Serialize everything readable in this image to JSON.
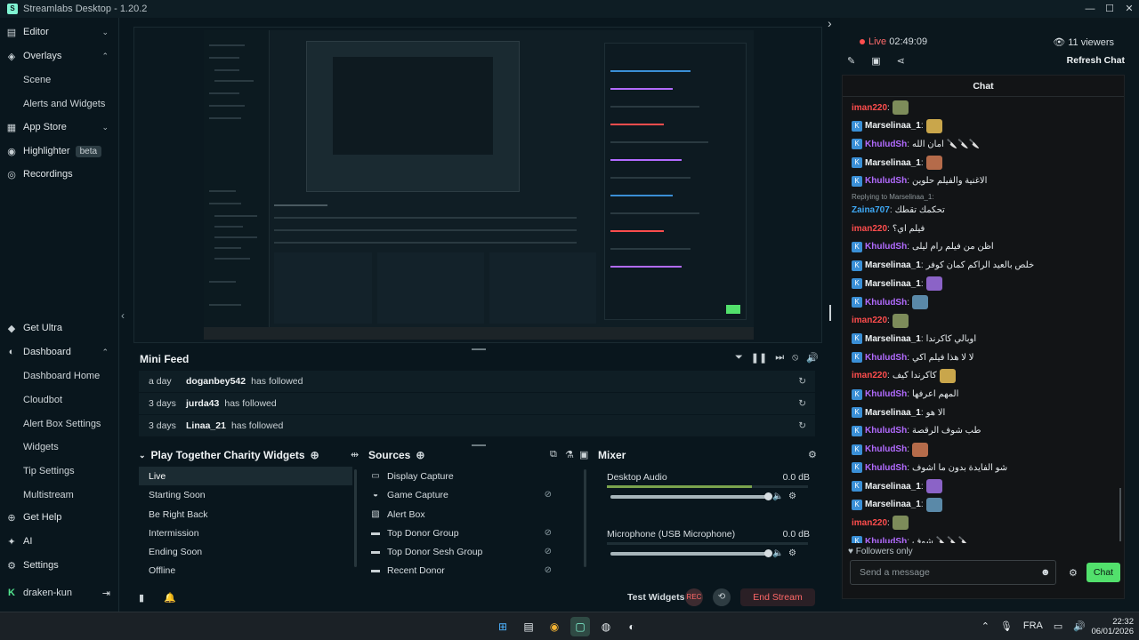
{
  "window": {
    "title": "Streamlabs Desktop - 1.20.2",
    "logo": "sl-logo"
  },
  "sidebar": {
    "items": [
      {
        "label": "Editor",
        "icon": "editor-icon"
      },
      {
        "label": "Overlays",
        "icon": "overlays-icon"
      },
      {
        "label": "Scene"
      },
      {
        "label": "Alerts and Widgets"
      },
      {
        "label": "App Store",
        "icon": "app-store-icon"
      },
      {
        "label": "Highlighter",
        "icon": "highlighter-icon",
        "badge": "beta"
      },
      {
        "label": "Recordings",
        "icon": "recordings-icon"
      },
      {
        "label": "Get Ultra",
        "icon": "ultra-icon"
      },
      {
        "label": "Dashboard",
        "icon": "dashboard-icon"
      },
      {
        "label": "Dashboard Home"
      },
      {
        "label": "Cloudbot"
      },
      {
        "label": "Alert Box Settings"
      },
      {
        "label": "Widgets"
      },
      {
        "label": "Tip Settings"
      },
      {
        "label": "Multistream"
      },
      {
        "label": "Get Help",
        "icon": "help-icon"
      },
      {
        "label": "AI",
        "icon": "ai-icon"
      },
      {
        "label": "Settings",
        "icon": "settings-icon"
      }
    ],
    "user": "draken-kun"
  },
  "minifeed": {
    "title": "Mini Feed",
    "rows": [
      {
        "age": "a day",
        "user": "doganbey542",
        "action": "has followed"
      },
      {
        "age": "3 days",
        "user": "jurda43",
        "action": "has followed"
      },
      {
        "age": "3 days",
        "user": "Linaa_21",
        "action": "has followed"
      }
    ]
  },
  "scenes": {
    "title": "Play Together Charity Widgets",
    "items": [
      "Live",
      "Starting Soon",
      "Be Right Back",
      "Intermission",
      "Ending Soon",
      "Offline"
    ]
  },
  "sources": {
    "title": "Sources",
    "items": [
      {
        "label": "Display Capture",
        "icon": "monitor-icon"
      },
      {
        "label": "Game Capture",
        "icon": "gamepad-icon"
      },
      {
        "label": "Alert Box",
        "icon": "image-icon"
      },
      {
        "label": "Top Donor Group",
        "icon": "folder-icon"
      },
      {
        "label": "Top Donor Sesh Group",
        "icon": "folder-icon"
      },
      {
        "label": "Recent Donor",
        "icon": "folder-icon"
      }
    ]
  },
  "mixer": {
    "title": "Mixer",
    "channels": [
      {
        "name": "Desktop Audio",
        "db": "0.0 dB",
        "level": 0.72,
        "volume": 1.0
      },
      {
        "name": "Microphone (USB Microphone)",
        "db": "0.0 dB",
        "level": 0.0,
        "volume": 1.0
      }
    ]
  },
  "footer": {
    "test_widgets": "Test Widgets",
    "rec": "REC",
    "end_stream": "End Stream"
  },
  "chat": {
    "live_label": "Live",
    "live_time": "02:49:09",
    "viewers": "11 viewers",
    "refresh": "Refresh Chat",
    "header": "Chat",
    "messages": [
      {
        "user": "iman220",
        "color": "#ff4d4d",
        "text": "",
        "emote": true
      },
      {
        "user": "Marselinaa_1",
        "color": "#eef2f4",
        "text": "",
        "emote": true
      },
      {
        "user": "KhuludSh",
        "color": "#b26bff",
        "text": "امان الله 🔪🔪🔪"
      },
      {
        "user": "Marselinaa_1",
        "color": "#eef2f4",
        "text": "",
        "emote": true
      },
      {
        "user": "KhuludSh",
        "color": "#b26bff",
        "text": "الاغنية والفيلم حلوين"
      },
      {
        "user": "Zaina707",
        "color": "#3fa9f5",
        "text": "تحكمك تقطك",
        "reply": "Replying to Marselinaa_1:"
      },
      {
        "user": "iman220",
        "color": "#ff4d4d",
        "text": "فيلم اي؟"
      },
      {
        "user": "KhuludSh",
        "color": "#b26bff",
        "text": "اظن من فيلم رام ليلى"
      },
      {
        "user": "Marselinaa_1",
        "color": "#eef2f4",
        "text": "خلص بالعيد الراكم كمان كوفر"
      },
      {
        "user": "Marselinaa_1",
        "color": "#eef2f4",
        "text": "",
        "emote": true
      },
      {
        "user": "KhuludSh",
        "color": "#b26bff",
        "text": "",
        "emote": true
      },
      {
        "user": "iman220",
        "color": "#ff4d4d",
        "text": "",
        "emote": true
      },
      {
        "user": "Marselinaa_1",
        "color": "#eef2f4",
        "text": "اوبالي كاكرندا"
      },
      {
        "user": "KhuludSh",
        "color": "#b26bff",
        "text": "لا لا هذا فيلم اكي"
      },
      {
        "user": "iman220",
        "color": "#ff4d4d",
        "text": "كاكرندا كيف",
        "emote": true
      },
      {
        "user": "KhuludSh",
        "color": "#b26bff",
        "text": "المهم اعرفها"
      },
      {
        "user": "Marselinaa_1",
        "color": "#eef2f4",
        "text": "الا هو"
      },
      {
        "user": "KhuludSh",
        "color": "#b26bff",
        "text": "طب شوف الرقصة"
      },
      {
        "user": "KhuludSh",
        "color": "#b26bff",
        "text": "",
        "emote": true
      },
      {
        "user": "KhuludSh",
        "color": "#b26bff",
        "text": "شو الفايدة بدون ما اشوف"
      },
      {
        "user": "Marselinaa_1",
        "color": "#eef2f4",
        "text": "",
        "emote": true
      },
      {
        "user": "Marselinaa_1",
        "color": "#eef2f4",
        "text": "",
        "emote": true
      },
      {
        "user": "iman220",
        "color": "#ff4d4d",
        "text": "",
        "emote": true
      },
      {
        "user": "KhuludSh",
        "color": "#b26bff",
        "text": "شوف 🔪🔪🔪"
      }
    ],
    "followers_only": "Followers only",
    "placeholder": "Send a message",
    "send": "Chat"
  },
  "taskbar": {
    "lang": "FRA",
    "time": "22:32",
    "date": "06/01/2026"
  }
}
